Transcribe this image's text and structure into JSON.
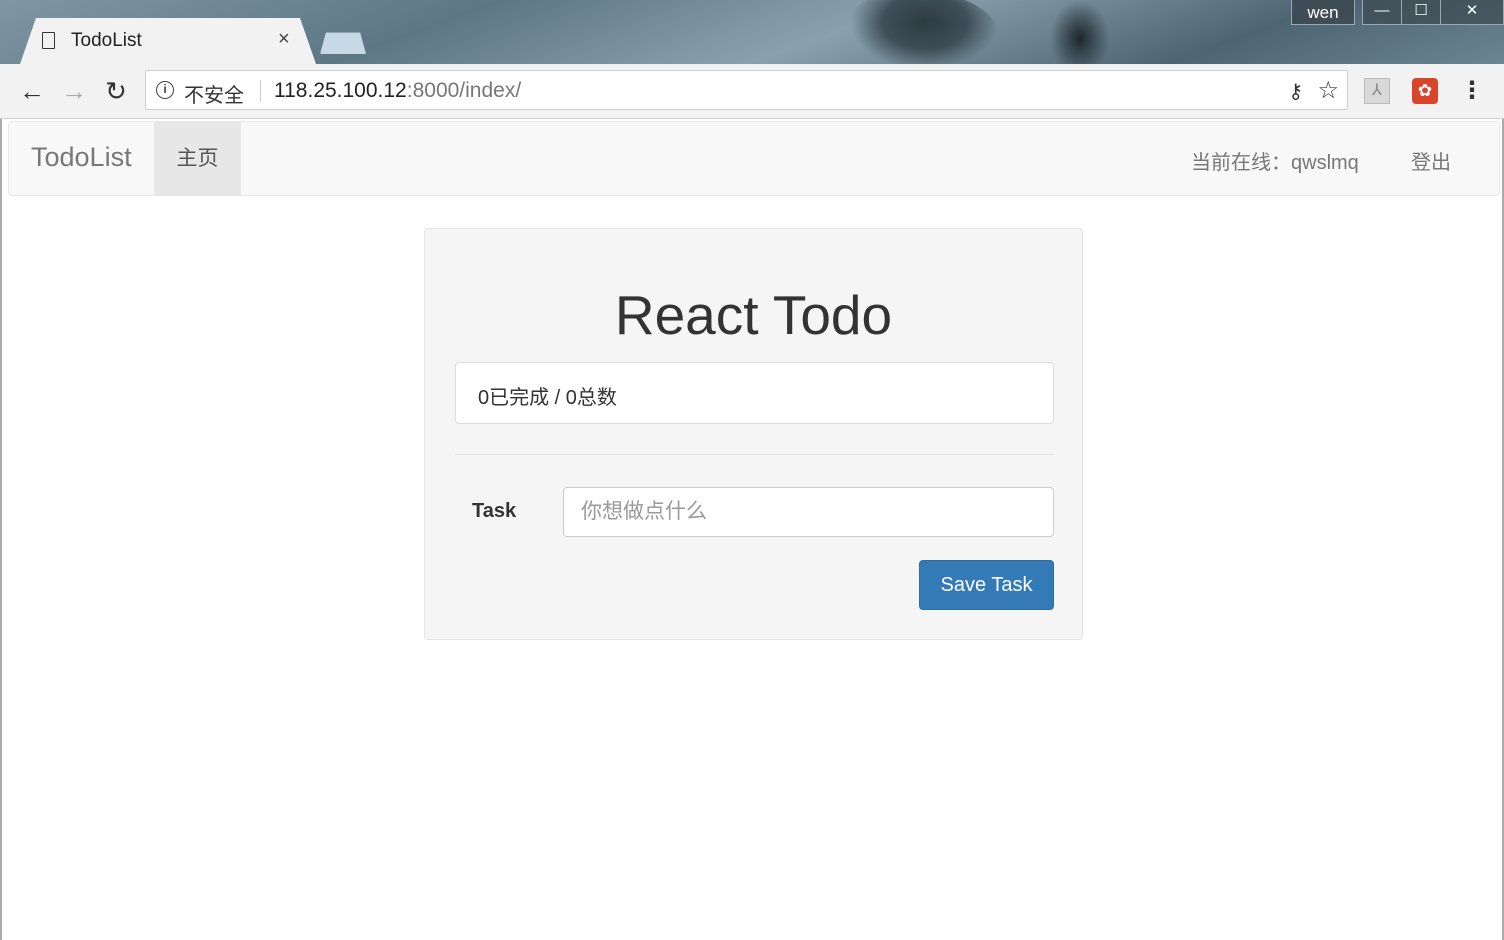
{
  "browser": {
    "tab_title": "TodoList",
    "tab_close": "×",
    "user": "wen",
    "window_controls": {
      "minimize": "—",
      "maximize": "☐",
      "close": "✕"
    },
    "nav": {
      "back": "←",
      "forward": "→",
      "reload": "↻"
    },
    "security_label": "不安全",
    "url_host": "118.25.100.12",
    "url_rest": ":8000/index/",
    "icons": [
      "info-icon",
      "key-icon",
      "star-icon",
      "pdf-extension-icon",
      "red-extension-icon",
      "menu-icon"
    ]
  },
  "navbar": {
    "brand": "TodoList",
    "home": "主页",
    "online_user": "当前在线：qwslmq",
    "logout": "登出"
  },
  "todo": {
    "title": "React Todo",
    "stats": "0已完成 / 0总数",
    "task_label": "Task",
    "task_placeholder": "你想做点什么",
    "task_value": "",
    "save_label": "Save Task"
  },
  "colors": {
    "primary_button": "#337ab7",
    "navbar_bg": "#f8f8f8",
    "panel_bg": "#f5f5f5"
  }
}
